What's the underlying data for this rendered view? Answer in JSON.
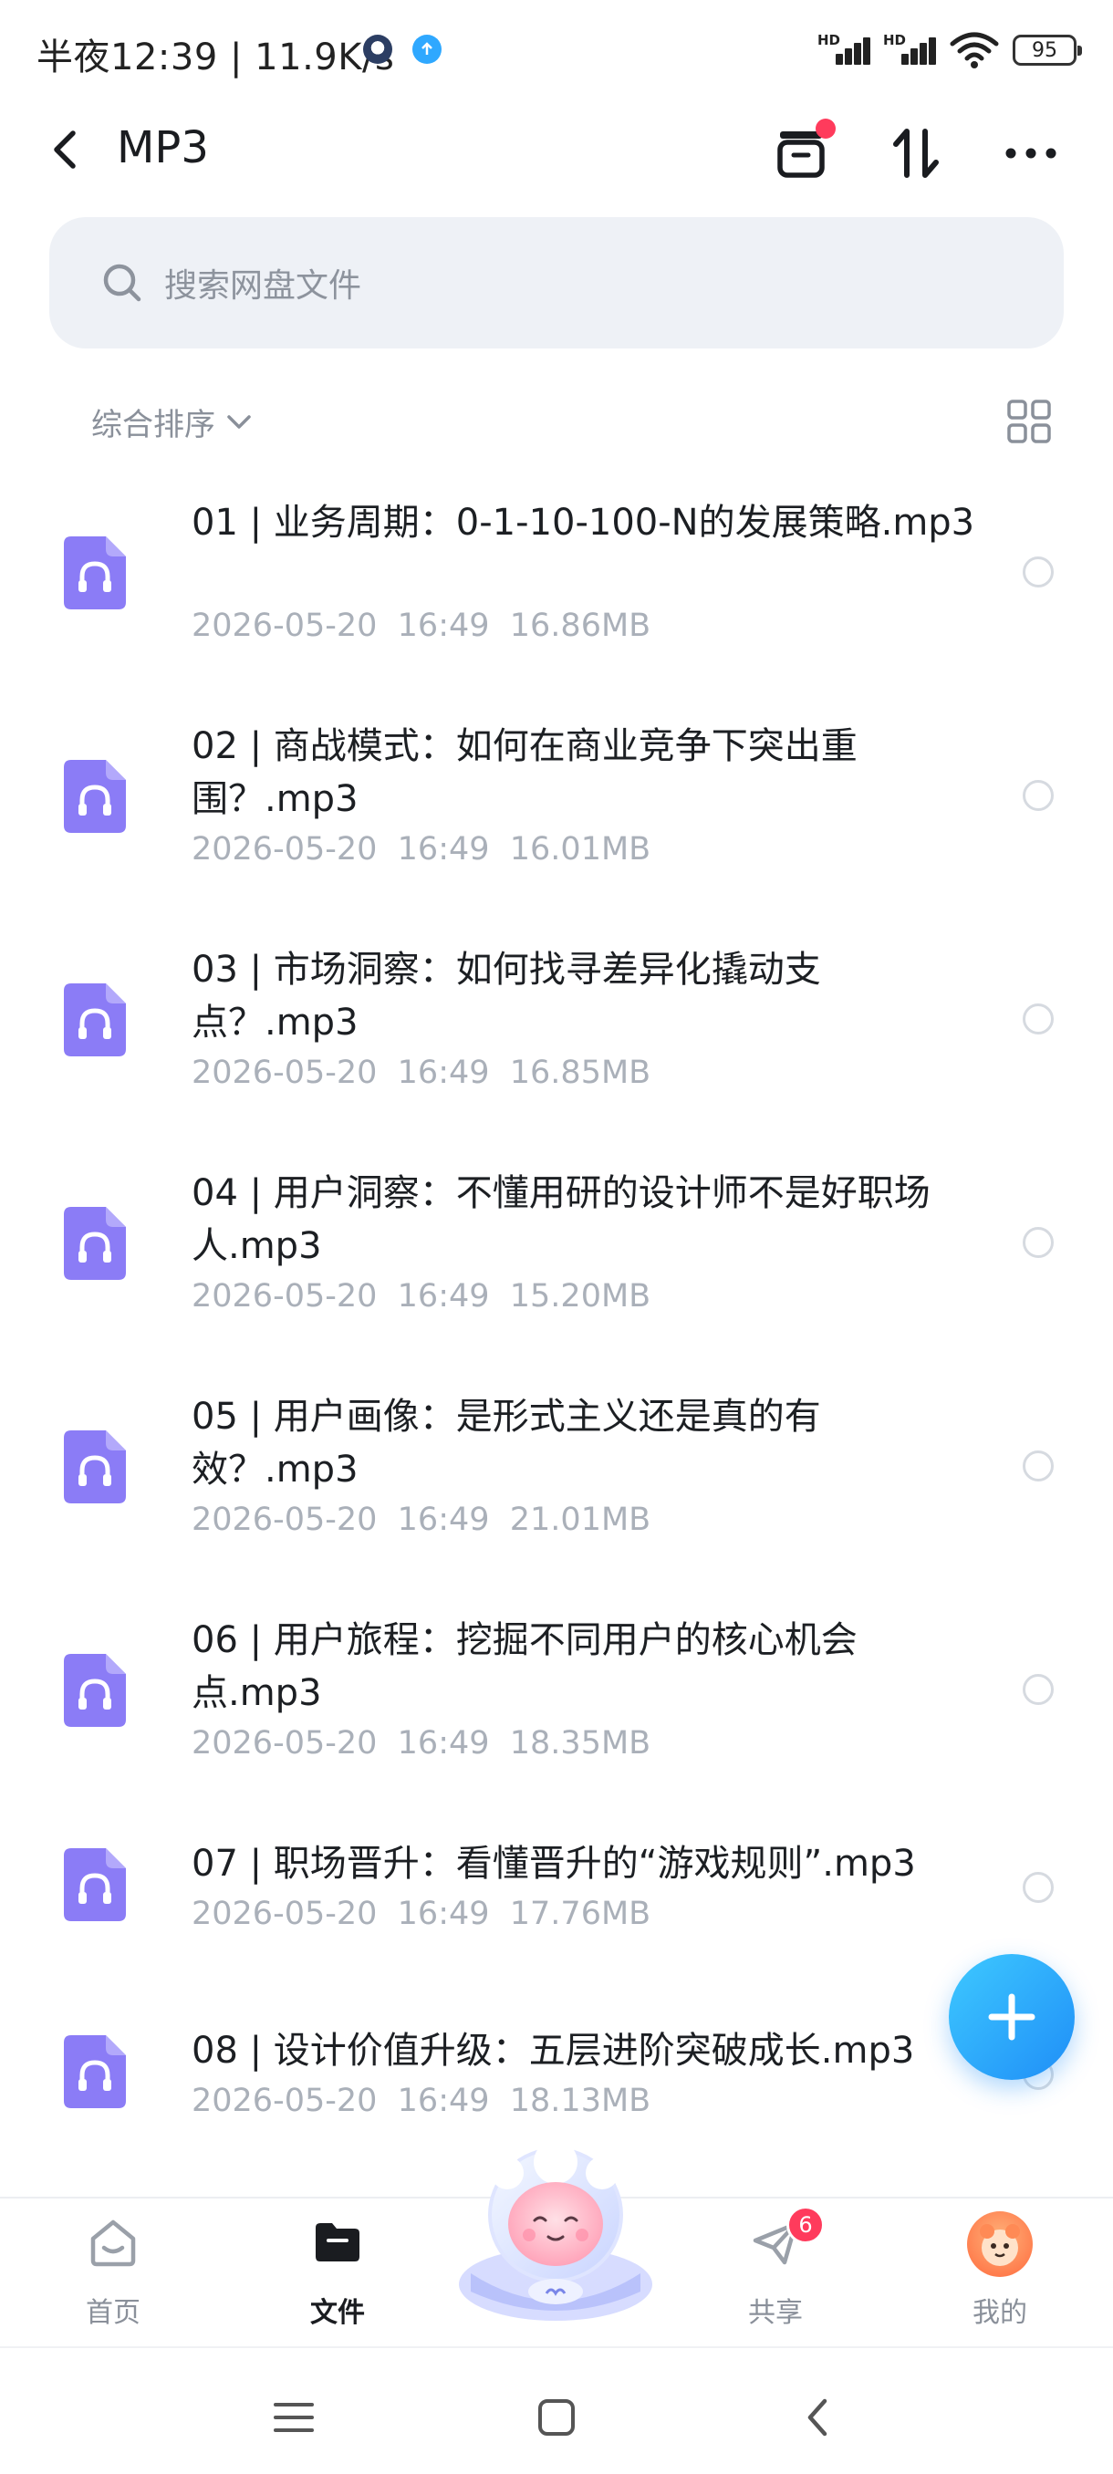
{
  "status_bar": {
    "time_speed": "半夜12:39 | 11.9K/s",
    "signal_label_1": "HD",
    "signal_label_2": "HD",
    "battery": "95"
  },
  "header": {
    "title": "MP3",
    "icons": [
      "back-arrow",
      "archive-box",
      "transfer-arrows",
      "more-dots"
    ]
  },
  "search": {
    "placeholder": "搜索网盘文件"
  },
  "sort": {
    "label": "综合排序"
  },
  "files": [
    {
      "name": "01 | 业务周期：0-1-10-100-N的发展策略.mp3",
      "meta": "2026-05-20  16:49  16.86MB"
    },
    {
      "name": "02 | 商战模式：如何在商业竞争下突出重围？.mp3",
      "meta": "2026-05-20  16:49  16.01MB"
    },
    {
      "name": "03 | 市场洞察：如何找寻差异化撬动支点？.mp3",
      "meta": "2026-05-20  16:49  16.85MB"
    },
    {
      "name": "04 | 用户洞察：不懂用研的设计师不是好职场人.mp3",
      "meta": "2026-05-20  16:49  15.20MB"
    },
    {
      "name": "05 | 用户画像：是形式主义还是真的有效？.mp3",
      "meta": "2026-05-20  16:49  21.01MB"
    },
    {
      "name": "06 | 用户旅程：挖掘不同用户的核心机会点.mp3",
      "meta": "2026-05-20  16:49  18.35MB"
    },
    {
      "name": "07 | 职场晋升：看懂晋升的“游戏规则”.mp3",
      "meta": "2026-05-20  16:49  17.76MB"
    },
    {
      "name": "08 | 设计价值升级：五层进阶突破成长.mp3",
      "meta": "2026-05-20  16:49  18.13MB"
    }
  ],
  "bottom_nav": {
    "home": "首页",
    "files": "文件",
    "share": "共享",
    "share_badge": "6",
    "me": "我的"
  },
  "colors": {
    "accent": "#1f8ef7",
    "file_icon": "#8b7cf6",
    "badge": "#ff3b5c"
  }
}
